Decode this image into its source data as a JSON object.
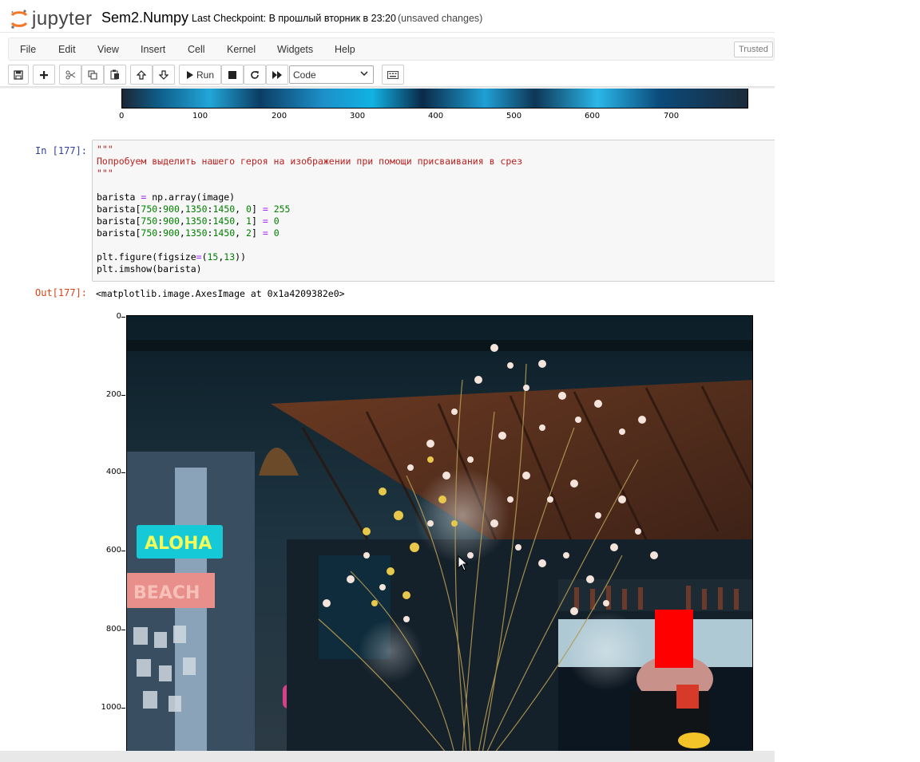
{
  "app": {
    "logo_text": "jupyter",
    "notebook_name": "Sem2.Numpy",
    "checkpoint": "Last Checkpoint: В прошлый вторник в 23:20",
    "unsaved": "(unsaved changes)",
    "trusted": "Trusted"
  },
  "menu": [
    "File",
    "Edit",
    "View",
    "Insert",
    "Cell",
    "Kernel",
    "Widgets",
    "Help"
  ],
  "toolbar": {
    "run_label": "Run",
    "cell_type": "Code",
    "icons": [
      "save-icon",
      "plus-icon",
      "cut-icon",
      "copy-icon",
      "paste-icon",
      "arrow-up-icon",
      "arrow-down-icon",
      "run-icon",
      "stop-icon",
      "restart-icon",
      "fast-forward-icon",
      "keyboard-icon"
    ]
  },
  "prev_output": {
    "x_ticks": [
      "0",
      "100",
      "200",
      "300",
      "400",
      "500",
      "600",
      "700"
    ]
  },
  "cell": {
    "in_prompt": "In [177]:",
    "out_prompt": "Out[177]:",
    "lines": [
      "\"\"\"",
      "Попробуем выделить нашего героя на изображении при помощи присваивания в срез",
      "\"\"\"",
      "",
      "barista = np.array(image)",
      "barista[750:900,1350:1450, 0] = 255",
      "barista[750:900,1350:1450, 1] = 0",
      "barista[750:900,1350:1450, 2] = 0",
      "",
      "plt.figure(figsize=(15,13))",
      "plt.imshow(barista)"
    ],
    "output_text": "<matplotlib.image.AxesImage at 0x1a4209382e0>"
  },
  "figure": {
    "y_ticks": [
      "0",
      "200",
      "400",
      "600",
      "800",
      "1000"
    ],
    "sign_aloha": "ALOHA",
    "sign_beach": "BEACH",
    "highlight_color": "#ff0000"
  }
}
